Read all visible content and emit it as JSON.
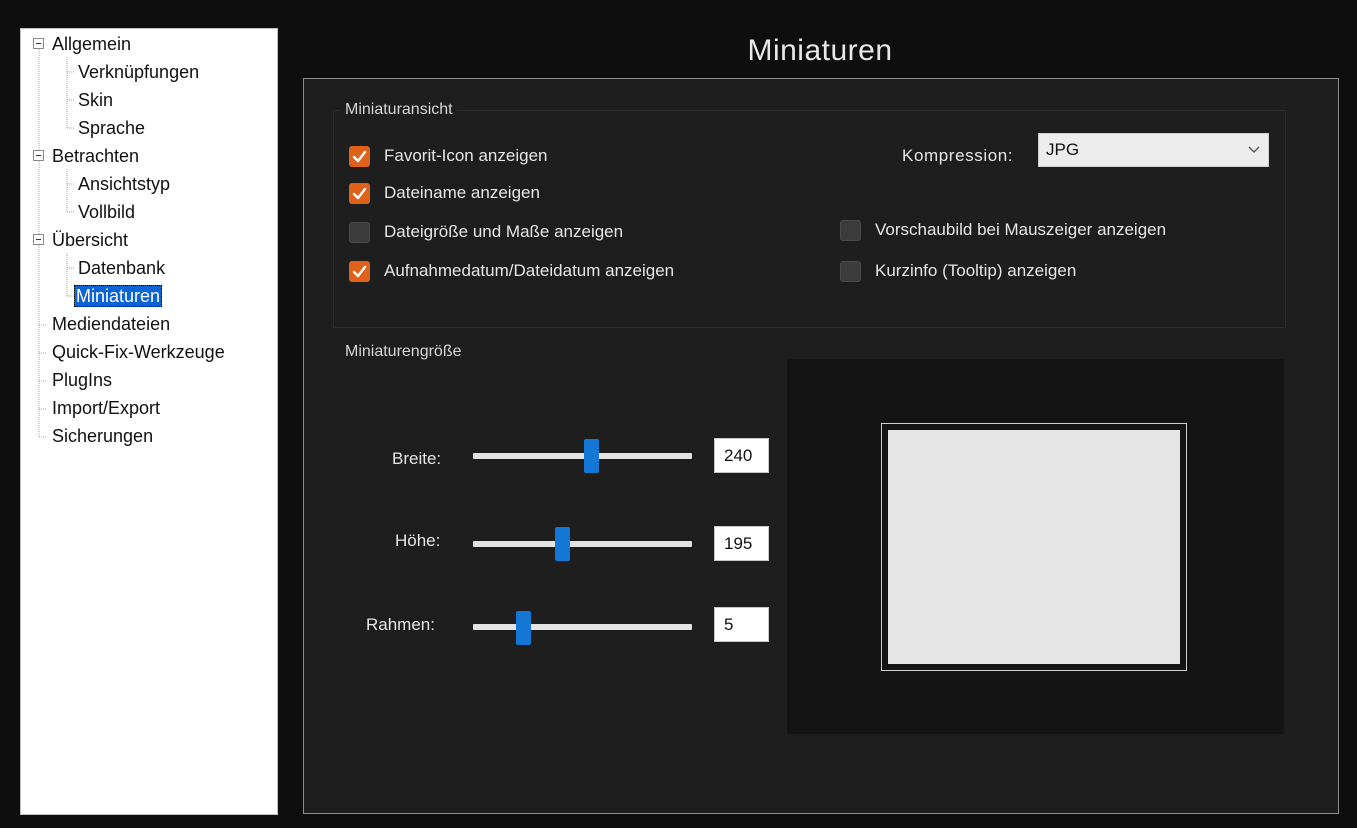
{
  "tree": {
    "items": [
      {
        "label": "Allgemein",
        "level": 0,
        "expandable": true
      },
      {
        "label": "Verknüpfungen",
        "level": 1
      },
      {
        "label": "Skin",
        "level": 1
      },
      {
        "label": "Sprache",
        "level": 1
      },
      {
        "label": "Betrachten",
        "level": 0,
        "expandable": true
      },
      {
        "label": "Ansichtstyp",
        "level": 1
      },
      {
        "label": "Vollbild",
        "level": 1
      },
      {
        "label": "Übersicht",
        "level": 0,
        "expandable": true
      },
      {
        "label": "Datenbank",
        "level": 1
      },
      {
        "label": "Miniaturen",
        "level": 1,
        "selected": true
      },
      {
        "label": "Mediendateien",
        "level": 0
      },
      {
        "label": "Quick-Fix-Werkzeuge",
        "level": 0
      },
      {
        "label": "PlugIns",
        "level": 0
      },
      {
        "label": "Import/Export",
        "level": 0
      },
      {
        "label": "Sicherungen",
        "level": 0
      }
    ]
  },
  "page": {
    "title": "Miniaturen"
  },
  "view_group": {
    "title": "Miniaturansicht",
    "options": {
      "favorit": {
        "label": "Favorit-Icon anzeigen",
        "checked": true
      },
      "dateiname": {
        "label": "Dateiname anzeigen",
        "checked": true
      },
      "dateigroesse": {
        "label": "Dateigröße und Maße anzeigen",
        "checked": false
      },
      "aufnahmedatum": {
        "label": "Aufnahmedatum/Dateidatum anzeigen",
        "checked": true
      },
      "vorschaubild": {
        "label": "Vorschaubild bei Mauszeiger anzeigen",
        "checked": false
      },
      "kurzinfo": {
        "label": "Kurzinfo (Tooltip) anzeigen",
        "checked": false
      }
    },
    "kompression": {
      "label": "Kompression:",
      "value": "JPG"
    }
  },
  "size_group": {
    "title": "Miniaturengröße",
    "breite": {
      "label": "Breite:",
      "value": "240",
      "slider_fraction": 0.54
    },
    "hoehe": {
      "label": "Höhe:",
      "value": "195",
      "slider_fraction": 0.41
    },
    "rahmen": {
      "label": "Rahmen:",
      "value": "5",
      "slider_fraction": 0.23
    }
  },
  "colors": {
    "accent_checkbox": "#e0611a",
    "slider_thumb": "#1477d6",
    "selection": "#0a64d6"
  }
}
